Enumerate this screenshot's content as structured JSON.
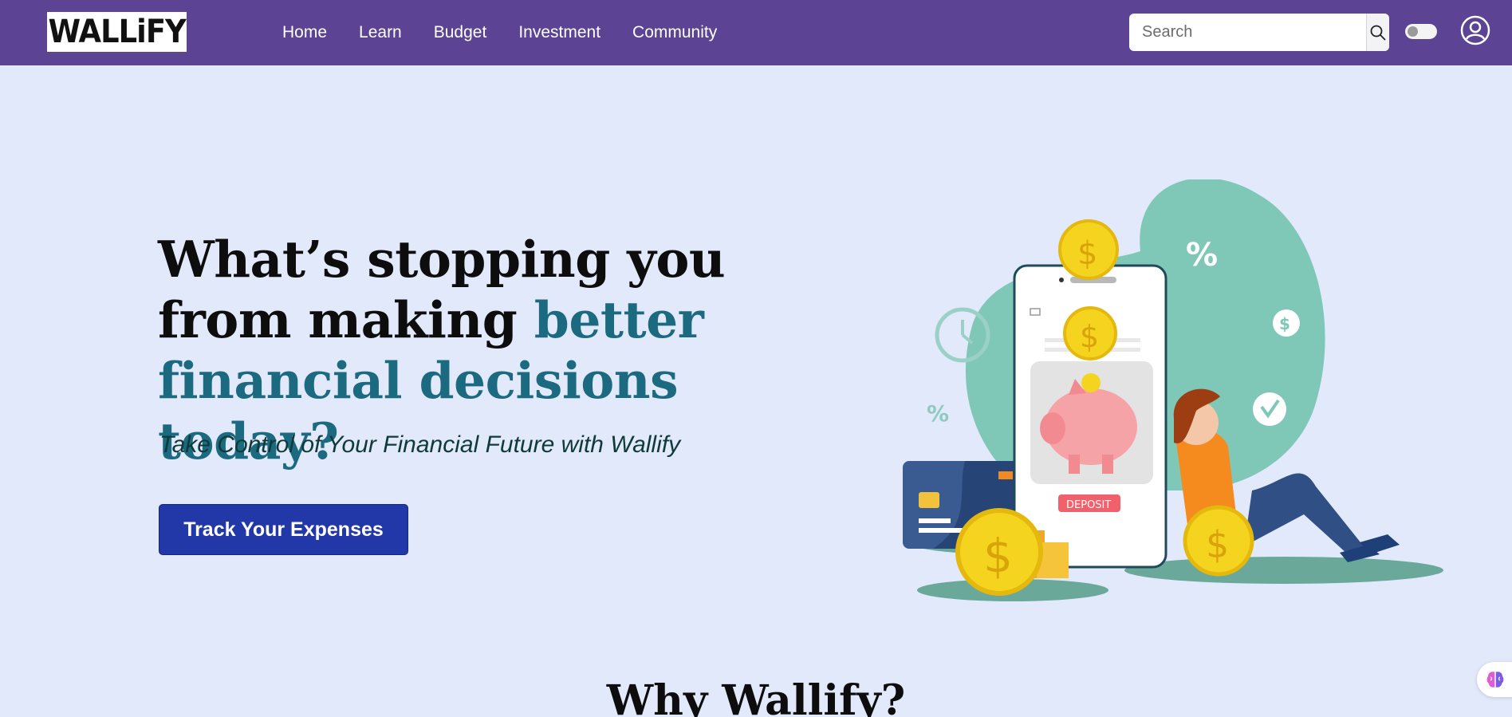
{
  "brand": {
    "logo_text": "WALLiFY"
  },
  "nav": {
    "links": [
      "Home",
      "Learn",
      "Budget",
      "Investment",
      "Community"
    ]
  },
  "search": {
    "placeholder": "Search"
  },
  "hero": {
    "title_part1": "What’s stopping you from making ",
    "title_accent": "better financial decisions today?",
    "subtitle": "Take Control of Your Financial Future with Wallify",
    "cta_label": "Track Your Expenses"
  },
  "illustration": {
    "phone_button_label": "DEPOSIT",
    "percent_symbol": "%",
    "dollar_symbol": "$"
  },
  "why": {
    "title": "Why Wallify?"
  },
  "colors": {
    "navbar": "#5c4394",
    "background": "#e2e9fa",
    "accent_text": "#1b6a80",
    "cta": "#2237a8"
  },
  "icons": {
    "search": "magnifier-icon",
    "theme_toggle": "toggle-switch-icon",
    "account": "user-circle-icon",
    "assistant": "brain-icon"
  }
}
